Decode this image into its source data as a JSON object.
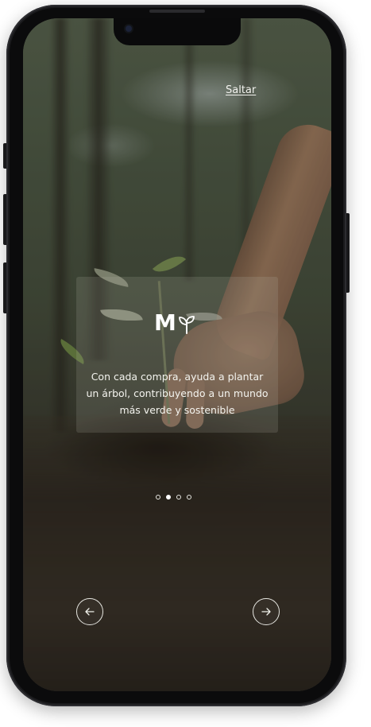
{
  "onboarding": {
    "skip_label": "Saltar",
    "logo_letter": "M",
    "logo_icon": "sprout-icon",
    "message": "Con cada compra, ayuda a plantar un árbol, contribuyendo a un mundo más verde y sostenible",
    "pagination": {
      "total": 4,
      "active_index": 1
    },
    "prev_icon": "arrow-left-icon",
    "next_icon": "arrow-right-icon"
  },
  "colors": {
    "text": "#f4f4ef",
    "card_overlay": "#bebeb4"
  }
}
